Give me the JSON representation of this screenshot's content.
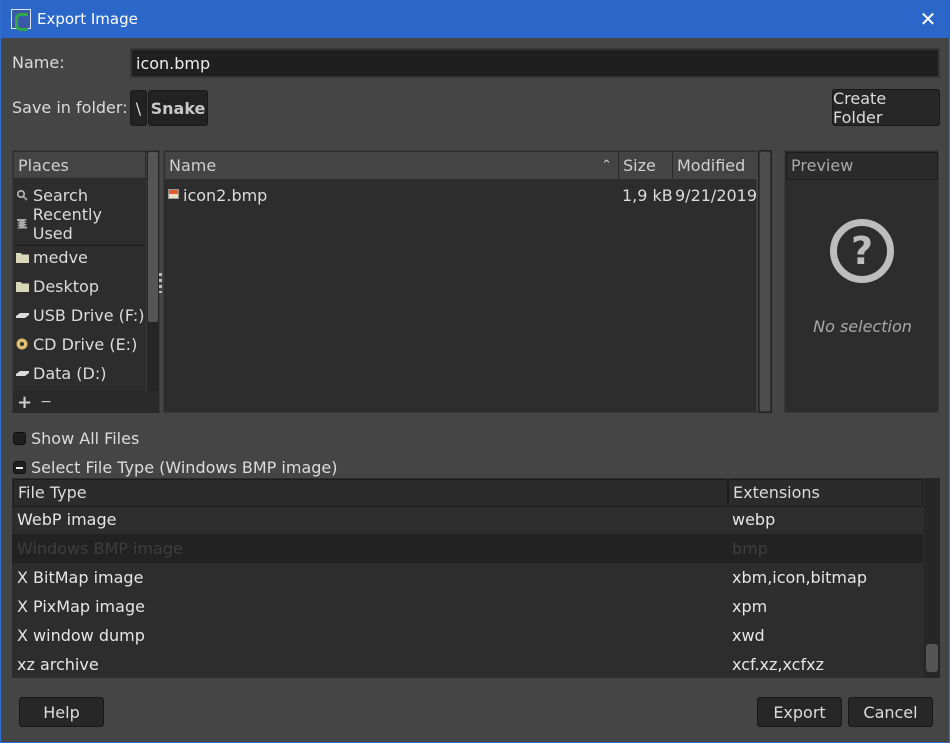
{
  "window": {
    "title": "Export Image",
    "close_icon": "close-icon",
    "app_icon": "gimp-snake-icon"
  },
  "name_field": {
    "label": "Name:",
    "value": "icon.bmp"
  },
  "save_in": {
    "label": "Save in folder:",
    "breadcrumbs": [
      "\\",
      "Snake"
    ],
    "create_folder_label": "Create Folder"
  },
  "places": {
    "header": "Places",
    "items": [
      {
        "label": "Search",
        "icon": "search-icon"
      },
      {
        "label": "Recently Used",
        "icon": "recent-icon"
      },
      {
        "label": "medve",
        "icon": "folder-icon"
      },
      {
        "label": "Desktop",
        "icon": "folder-icon"
      },
      {
        "label": "USB Drive (F:)",
        "icon": "drive-icon"
      },
      {
        "label": "CD Drive (E:)",
        "icon": "cd-icon"
      },
      {
        "label": "Data (D:)",
        "icon": "drive-icon"
      }
    ],
    "add_symbol": "+",
    "remove_symbol": "−"
  },
  "files": {
    "columns": {
      "name": "Name",
      "size": "Size",
      "modified": "Modified"
    },
    "sort_indicator": "^",
    "rows": [
      {
        "name": "icon2.bmp",
        "size": "1,9 kB",
        "modified": "9/21/2019",
        "icon": "image-file-icon"
      }
    ]
  },
  "preview": {
    "header": "Preview",
    "icon": "question-icon",
    "empty_text": "No selection"
  },
  "options": {
    "show_all_files": "Show All Files",
    "show_all_files_checked": false,
    "select_file_type": "Select File Type (Windows BMP image)",
    "select_file_type_expanded": true
  },
  "file_types": {
    "columns": {
      "type": "File Type",
      "extensions": "Extensions"
    },
    "rows": [
      {
        "type": "WebP image",
        "ext": "webp",
        "selected": false
      },
      {
        "type": "Windows BMP image",
        "ext": "bmp",
        "selected": true
      },
      {
        "type": "X BitMap image",
        "ext": "xbm,icon,bitmap",
        "selected": false
      },
      {
        "type": "X PixMap image",
        "ext": "xpm",
        "selected": false
      },
      {
        "type": "X window dump",
        "ext": "xwd",
        "selected": false
      },
      {
        "type": "xz archive",
        "ext": "xcf.xz,xcfxz",
        "selected": false
      }
    ]
  },
  "buttons": {
    "help": "Help",
    "export": "Export",
    "cancel": "Cancel"
  },
  "colors": {
    "titlebar": "#2a67c8",
    "background": "#454545",
    "panel": "#2d2d2d"
  }
}
